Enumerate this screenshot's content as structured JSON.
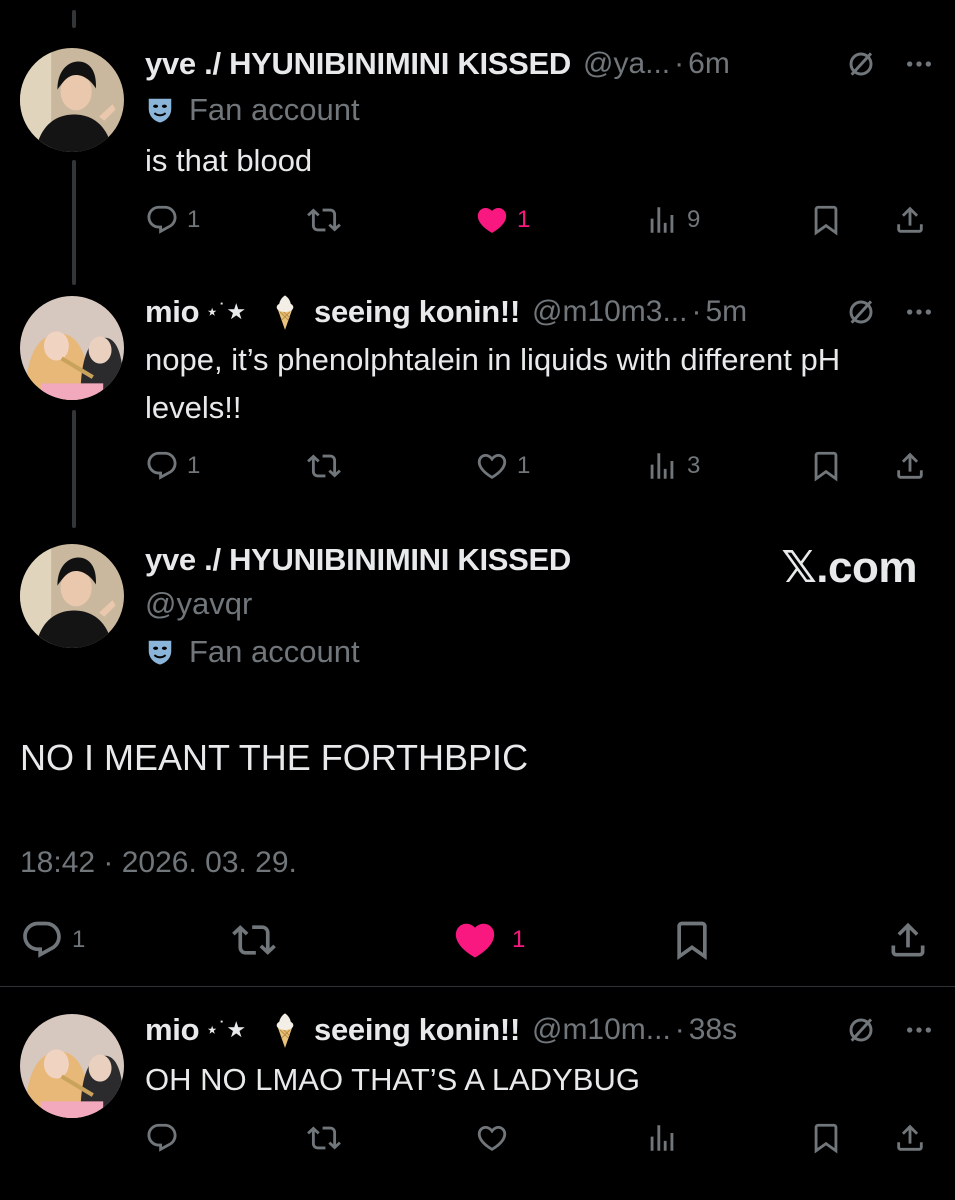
{
  "post1": {
    "name": "yve ./ HYUNIBINIMINI KISSED",
    "handle": "@ya...",
    "time": "6m",
    "badge": "Fan account",
    "text": "is that blood",
    "replies": "1",
    "likes": "1",
    "views": "9",
    "liked": true
  },
  "post2": {
    "name": "mio",
    "sparkle": "⋆˙★",
    "name_suffix": "seeing konin!!",
    "handle": "@m10m3...",
    "time": "5m",
    "text": "nope, it’s phenolphtalein in liquids with different pH levels!!",
    "replies": "1",
    "likes": "1",
    "views": "3",
    "liked": false
  },
  "main": {
    "name": "yve ./ HYUNIBINIMINI KISSED",
    "handle": "@yavqr",
    "badge": "Fan account",
    "watermark": "𝕏.com",
    "text": "NO I MEANT THE FORTHBPIC",
    "timestamp": "18:42 · 2026. 03. 29.",
    "replies": "1",
    "likes": "1",
    "liked": true
  },
  "post3": {
    "name": "mio",
    "sparkle": "⋆˙★",
    "name_suffix": "seeing konin!!",
    "handle": "@m10m...",
    "time": "38s",
    "text": "OH NO LMAO THAT’S A LADYBUG"
  },
  "separator": "·",
  "icons": {
    "reply": "reply-icon",
    "repost": "repost-icon",
    "like": "heart-icon",
    "views": "views-icon",
    "bookmark": "bookmark-icon",
    "share": "share-icon",
    "grok": "grok-icon",
    "more": "more-icon",
    "badge": "mask-icon"
  },
  "colors": {
    "background": "#000000",
    "text": "#e7e9ea",
    "muted": "#71767b",
    "like": "#f91880"
  }
}
